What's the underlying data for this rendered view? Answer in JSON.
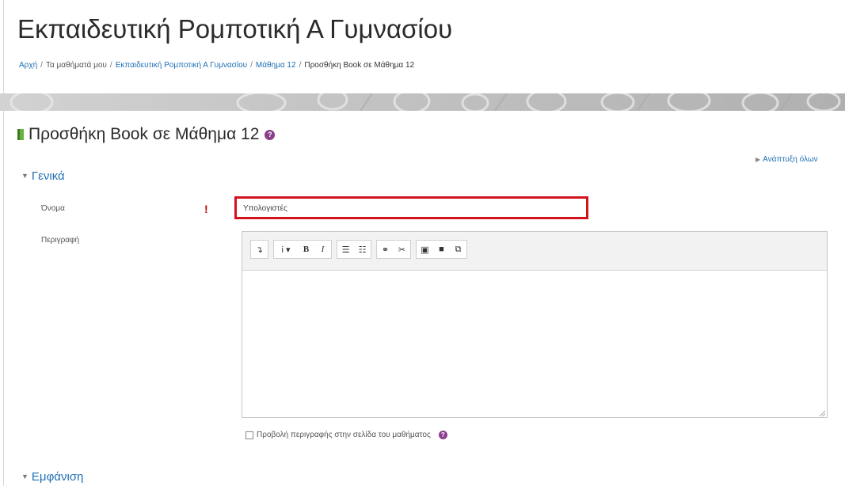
{
  "course_title": "Εκπαιδευτική Ρομποτική Α Γυμνασίου",
  "breadcrumb": [
    {
      "label": "Αρχή",
      "link": true
    },
    {
      "label": "Τα μαθήματά μου",
      "link": false
    },
    {
      "label": "Εκπαιδευτική Ρομποτική Α Γυμνασίου",
      "link": true
    },
    {
      "label": "Μάθημα 12",
      "link": true
    },
    {
      "label": "Προσθήκη Book σε Μάθημα 12",
      "link": false
    }
  ],
  "breadcrumb_separator": "/",
  "activity_title": "Προσθήκη Book σε Μάθημα 12",
  "help_glyph": "?",
  "expand_all_label": "Ανάπτυξη όλων",
  "sections": {
    "general": "Γενικά",
    "appearance": "Εμφάνιση"
  },
  "form": {
    "name_label": "Όνομα",
    "name_value": "Υπολογιστές",
    "required_glyph": "!",
    "description_label": "Περιγραφή",
    "show_description_label": "Προβολή περιγραφής στην σελίδα του μαθήματος"
  },
  "editor_toolbar": [
    [
      {
        "name": "toolbar-toggle-icon",
        "glyph": "↴"
      }
    ],
    [
      {
        "name": "paragraph-style-icon",
        "glyph": "i ▾",
        "wide": true
      },
      {
        "name": "bold-icon",
        "glyph": "B"
      },
      {
        "name": "italic-icon",
        "glyph": "I"
      }
    ],
    [
      {
        "name": "unordered-list-icon",
        "glyph": "☰"
      },
      {
        "name": "ordered-list-icon",
        "glyph": "☷"
      }
    ],
    [
      {
        "name": "link-icon",
        "glyph": "⚭"
      },
      {
        "name": "unlink-icon",
        "glyph": "✂"
      }
    ],
    [
      {
        "name": "image-icon",
        "glyph": "▣"
      },
      {
        "name": "media-icon",
        "glyph": "■"
      },
      {
        "name": "manage-files-icon",
        "glyph": "⧉"
      }
    ]
  ],
  "colors": {
    "link": "#1f6fb3",
    "required": "#c00000",
    "highlight_border": "#d2141e",
    "help": "#8a3d8c"
  }
}
